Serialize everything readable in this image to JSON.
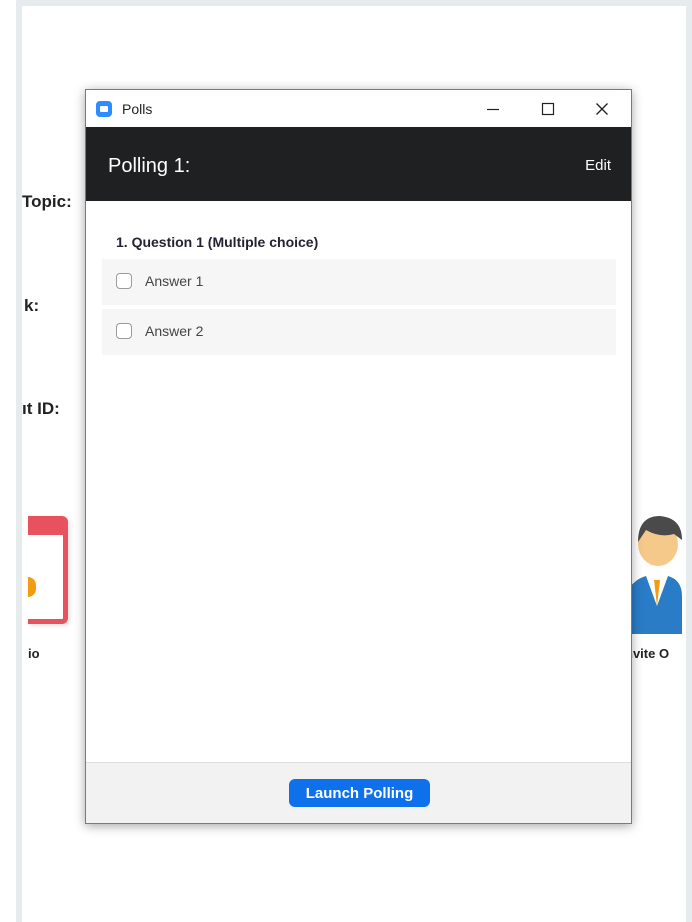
{
  "background": {
    "labels": {
      "topic": "Topic:",
      "link": "k:",
      "meeting_id": "ıt ID:",
      "audio": "io",
      "invite": "nvite O"
    }
  },
  "window": {
    "title": "Polls",
    "controls": {
      "minimize": "—",
      "maximize": "☐",
      "close": "✕"
    }
  },
  "poll": {
    "title": "Polling 1:",
    "edit_label": "Edit",
    "question": "1. Question 1 (Multiple choice)",
    "answers": [
      "Answer 1",
      "Answer 2"
    ]
  },
  "footer": {
    "launch_label": "Launch Polling"
  },
  "colors": {
    "header_bg": "#1f2021",
    "accent": "#0e71eb",
    "app_icon": "#2d8cff",
    "card_red": "#e8525e"
  }
}
